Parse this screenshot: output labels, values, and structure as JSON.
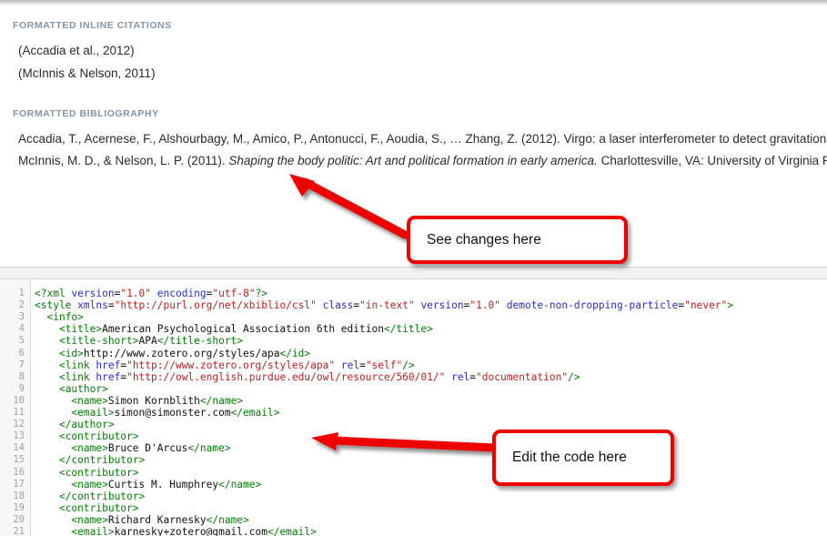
{
  "preview": {
    "inline_citations_header": "FORMATTED INLINE CITATIONS",
    "inline_citations": [
      "(Accadia et al., 2012)",
      "(McInnis & Nelson, 2011)"
    ],
    "bibliography_header": "FORMATTED BIBLIOGRAPHY",
    "bibliography": [
      {
        "prefix": "Accadia, T., Acernese, F., Alshourbagy, M., Amico, P., Antonucci, F., Aoudia, S., … Zhang, Z. (2012). Virgo: a laser interferometer to detect gravitational",
        "title": "",
        "suffix": ""
      },
      {
        "prefix": "McInnis, M. D., & Nelson, L. P. (2011). ",
        "title": "Shaping the body politic: Art and political formation in early america.",
        "suffix": " Charlottesville, VA: University of Virginia Pres"
      }
    ]
  },
  "editor": {
    "language": "xml",
    "lines": [
      {
        "n": "1",
        "tokens": [
          {
            "t": "pi",
            "v": "<?xml "
          },
          {
            "t": "attr",
            "v": "version"
          },
          {
            "t": "txt",
            "v": "="
          },
          {
            "t": "str",
            "v": "\"1.0\""
          },
          {
            "t": "txt",
            "v": " "
          },
          {
            "t": "attr",
            "v": "encoding"
          },
          {
            "t": "txt",
            "v": "="
          },
          {
            "t": "str",
            "v": "\"utf-8\""
          },
          {
            "t": "pi",
            "v": "?>"
          }
        ]
      },
      {
        "n": "2",
        "tokens": [
          {
            "t": "tag",
            "v": "<style "
          },
          {
            "t": "attr",
            "v": "xmlns"
          },
          {
            "t": "txt",
            "v": "="
          },
          {
            "t": "str",
            "v": "\"http://purl.org/net/xbiblio/csl\""
          },
          {
            "t": "txt",
            "v": " "
          },
          {
            "t": "attr",
            "v": "class"
          },
          {
            "t": "txt",
            "v": "="
          },
          {
            "t": "str",
            "v": "\"in-text\""
          },
          {
            "t": "txt",
            "v": " "
          },
          {
            "t": "attr",
            "v": "version"
          },
          {
            "t": "txt",
            "v": "="
          },
          {
            "t": "str",
            "v": "\"1.0\""
          },
          {
            "t": "txt",
            "v": " "
          },
          {
            "t": "attr",
            "v": "demote-non-dropping-particle"
          },
          {
            "t": "txt",
            "v": "="
          },
          {
            "t": "str",
            "v": "\"never\""
          },
          {
            "t": "tag",
            "v": ">"
          }
        ]
      },
      {
        "n": "3",
        "tokens": [
          {
            "t": "txt",
            "v": "  "
          },
          {
            "t": "tag",
            "v": "<info>"
          }
        ]
      },
      {
        "n": "4",
        "tokens": [
          {
            "t": "txt",
            "v": "    "
          },
          {
            "t": "tag",
            "v": "<title>"
          },
          {
            "t": "txt",
            "v": "American Psychological Association 6th edition"
          },
          {
            "t": "tag",
            "v": "</title>"
          }
        ]
      },
      {
        "n": "5",
        "tokens": [
          {
            "t": "txt",
            "v": "    "
          },
          {
            "t": "tag",
            "v": "<title-short>"
          },
          {
            "t": "txt",
            "v": "APA"
          },
          {
            "t": "tag",
            "v": "</title-short>"
          }
        ]
      },
      {
        "n": "6",
        "tokens": [
          {
            "t": "txt",
            "v": "    "
          },
          {
            "t": "tag",
            "v": "<id>"
          },
          {
            "t": "txt",
            "v": "http://www.zotero.org/styles/apa"
          },
          {
            "t": "tag",
            "v": "</id>"
          }
        ]
      },
      {
        "n": "7",
        "tokens": [
          {
            "t": "txt",
            "v": "    "
          },
          {
            "t": "tag",
            "v": "<link "
          },
          {
            "t": "attr",
            "v": "href"
          },
          {
            "t": "txt",
            "v": "="
          },
          {
            "t": "str",
            "v": "\"http://www.zotero.org/styles/apa\""
          },
          {
            "t": "txt",
            "v": " "
          },
          {
            "t": "attr",
            "v": "rel"
          },
          {
            "t": "txt",
            "v": "="
          },
          {
            "t": "str",
            "v": "\"self\""
          },
          {
            "t": "tag",
            "v": "/>"
          }
        ]
      },
      {
        "n": "8",
        "tokens": [
          {
            "t": "txt",
            "v": "    "
          },
          {
            "t": "tag",
            "v": "<link "
          },
          {
            "t": "attr",
            "v": "href"
          },
          {
            "t": "txt",
            "v": "="
          },
          {
            "t": "str",
            "v": "\"http://owl.english.purdue.edu/owl/resource/560/01/\""
          },
          {
            "t": "txt",
            "v": " "
          },
          {
            "t": "attr",
            "v": "rel"
          },
          {
            "t": "txt",
            "v": "="
          },
          {
            "t": "str",
            "v": "\"documentation\""
          },
          {
            "t": "tag",
            "v": "/>"
          }
        ]
      },
      {
        "n": "9",
        "tokens": [
          {
            "t": "txt",
            "v": "    "
          },
          {
            "t": "tag",
            "v": "<author>"
          }
        ]
      },
      {
        "n": "10",
        "tokens": [
          {
            "t": "txt",
            "v": "      "
          },
          {
            "t": "tag",
            "v": "<name>"
          },
          {
            "t": "txt",
            "v": "Simon Kornblith"
          },
          {
            "t": "tag",
            "v": "</name>"
          }
        ]
      },
      {
        "n": "11",
        "tokens": [
          {
            "t": "txt",
            "v": "      "
          },
          {
            "t": "tag",
            "v": "<email>"
          },
          {
            "t": "txt",
            "v": "simon@simonster.com"
          },
          {
            "t": "tag",
            "v": "</email>"
          }
        ]
      },
      {
        "n": "12",
        "tokens": [
          {
            "t": "txt",
            "v": "    "
          },
          {
            "t": "tag",
            "v": "</author>"
          }
        ]
      },
      {
        "n": "13",
        "tokens": [
          {
            "t": "txt",
            "v": "    "
          },
          {
            "t": "tag",
            "v": "<contributor>"
          }
        ]
      },
      {
        "n": "14",
        "tokens": [
          {
            "t": "txt",
            "v": "      "
          },
          {
            "t": "tag",
            "v": "<name>"
          },
          {
            "t": "txt",
            "v": "Bruce D'Arcus"
          },
          {
            "t": "tag",
            "v": "</name>"
          }
        ]
      },
      {
        "n": "15",
        "tokens": [
          {
            "t": "txt",
            "v": "    "
          },
          {
            "t": "tag",
            "v": "</contributor>"
          }
        ]
      },
      {
        "n": "16",
        "tokens": [
          {
            "t": "txt",
            "v": "    "
          },
          {
            "t": "tag",
            "v": "<contributor>"
          }
        ]
      },
      {
        "n": "17",
        "tokens": [
          {
            "t": "txt",
            "v": "      "
          },
          {
            "t": "tag",
            "v": "<name>"
          },
          {
            "t": "txt",
            "v": "Curtis M. Humphrey"
          },
          {
            "t": "tag",
            "v": "</name>"
          }
        ]
      },
      {
        "n": "18",
        "tokens": [
          {
            "t": "txt",
            "v": "    "
          },
          {
            "t": "tag",
            "v": "</contributor>"
          }
        ]
      },
      {
        "n": "19",
        "tokens": [
          {
            "t": "txt",
            "v": "    "
          },
          {
            "t": "tag",
            "v": "<contributor>"
          }
        ]
      },
      {
        "n": "20",
        "tokens": [
          {
            "t": "txt",
            "v": "      "
          },
          {
            "t": "tag",
            "v": "<name>"
          },
          {
            "t": "txt",
            "v": "Richard Karnesky"
          },
          {
            "t": "tag",
            "v": "</name>"
          }
        ]
      },
      {
        "n": "21",
        "tokens": [
          {
            "t": "txt",
            "v": "      "
          },
          {
            "t": "tag",
            "v": "<email>"
          },
          {
            "t": "txt",
            "v": "karnesky+zotero@gmail.com"
          },
          {
            "t": "tag",
            "v": "</email>"
          }
        ]
      }
    ]
  },
  "annotations": {
    "accent_color": "#ee0000",
    "callouts": [
      {
        "label": "See changes here"
      },
      {
        "label": "Edit the code here"
      }
    ],
    "arrows": [
      {
        "name": "arrow-see-changes",
        "direction": "up-left"
      },
      {
        "name": "arrow-edit-code",
        "direction": "left"
      }
    ]
  }
}
